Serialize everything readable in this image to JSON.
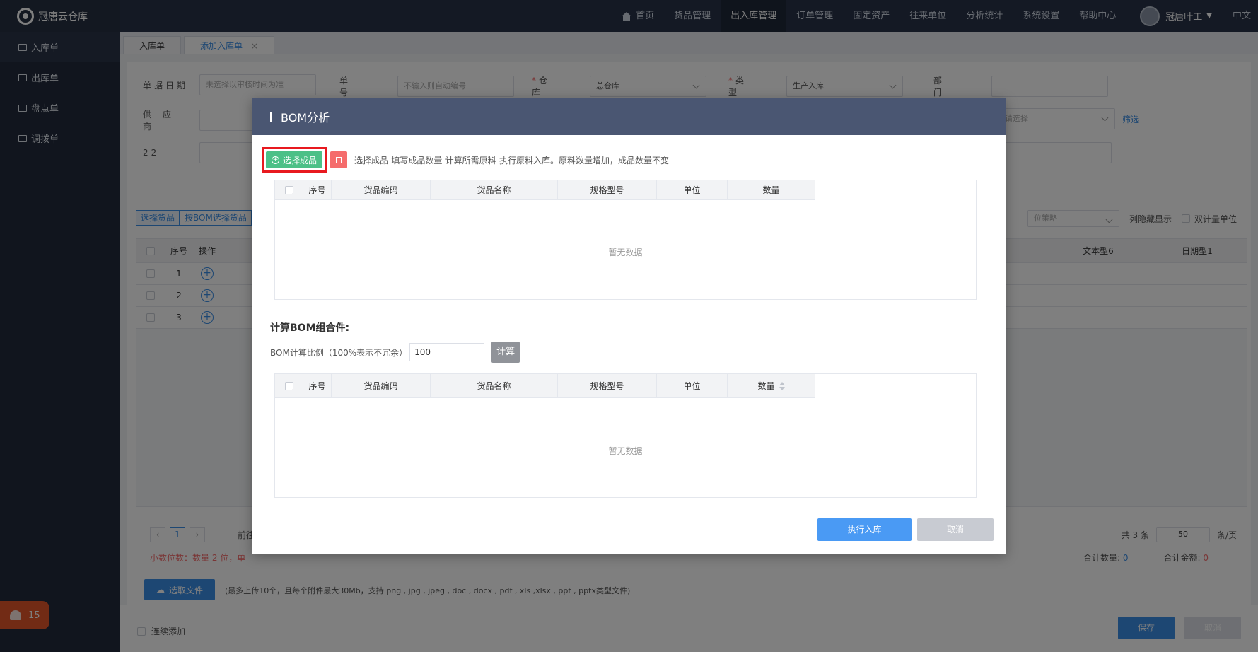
{
  "app": {
    "logo_text": "冠唐云仓库"
  },
  "nav": {
    "items": [
      "首页",
      "货品管理",
      "出入库管理",
      "订单管理",
      "固定资产",
      "往来单位",
      "分析统计",
      "系统设置",
      "帮助中心"
    ],
    "active_index": 2,
    "user_name": "冠唐叶工",
    "language": "中文"
  },
  "sidebar": {
    "items": [
      "入库单",
      "出库单",
      "盘点单",
      "调拨单"
    ],
    "alarm_count": "15"
  },
  "tabs": {
    "items": [
      "入库单",
      "添加入库单"
    ]
  },
  "form": {
    "date_label": "单据日期",
    "date_placeholder": "未选择以审核时间为准",
    "number_label": "单号",
    "number_placeholder": "不输入则自动编号",
    "warehouse_label": "仓库",
    "warehouse_value": "总仓库",
    "type_label": "类型",
    "type_value": "生产入库",
    "dept_label": "部门",
    "supplier_label": "供应商",
    "field22_label": "22",
    "select_placeholder": "请选择",
    "filter_link": "筛选"
  },
  "goods": {
    "tab_select": "选择货品",
    "tab_bom": "按BOM选择货品",
    "strategy_placeholder": "位策略",
    "hide_cols": "列隐藏显示",
    "dual_unit": "双计量单位",
    "col_seq": "序号",
    "col_op": "操作",
    "col_text6": "文本型6",
    "col_date1": "日期型1",
    "rows": [
      "1",
      "2",
      "3"
    ],
    "goto_label": "前往",
    "page_current": "1",
    "total_label": "共 3 条",
    "page_size": "50",
    "per_page_label": "条/页",
    "decimal_note": "小数位数：数量 2 位，单",
    "sum_qty_label": "合计数量:",
    "sum_qty": "0",
    "sum_amount_label": "合计金额:",
    "sum_amount": "0"
  },
  "attachments": {
    "button": "选取文件",
    "tip": "(最多上传10个，且每个附件最大30Mb，支持 png , jpg , jpeg , doc , docx , pdf , xls ,xlsx , ppt , pptx类型文件)"
  },
  "footer": {
    "continue_add": "连续添加",
    "save": "保存",
    "cancel": "取消"
  },
  "modal": {
    "title": "BOM分析",
    "select_product": "选择成品",
    "tip": "选择成品-填写成品数量-计算所需原料-执行原料入库。原料数量增加，成品数量不变",
    "columns": [
      "序号",
      "货品编码",
      "货品名称",
      "规格型号",
      "单位",
      "数量"
    ],
    "empty_text": "暂无数据",
    "calc_title": "计算BOM组合件:",
    "ratio_label": "BOM计算比例（100%表示不冗余）",
    "ratio_value": "100",
    "calc_button": "计算",
    "execute_button": "执行入库",
    "cancel_button": "取消"
  }
}
